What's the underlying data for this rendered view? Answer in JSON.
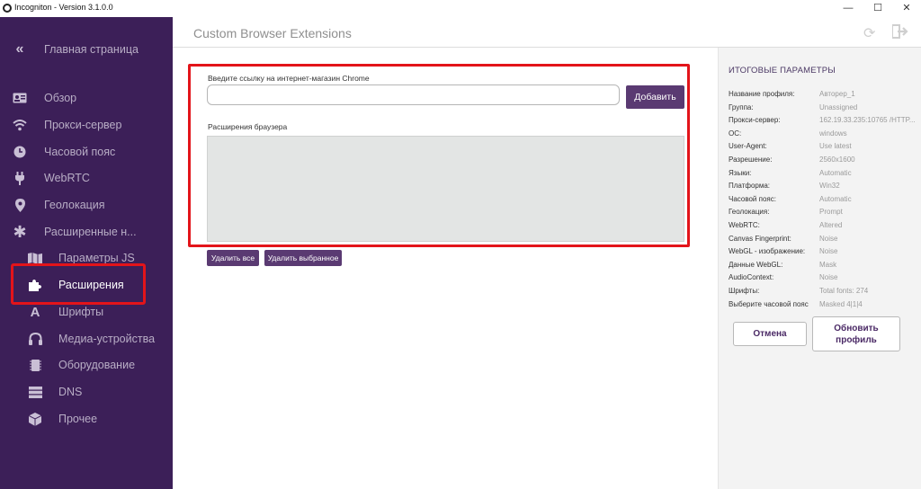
{
  "window": {
    "title": "Incogniton - Version 3.1.0.0",
    "controls": {
      "minimize": "—",
      "maximize": "☐",
      "close": "✕"
    }
  },
  "sidebar": {
    "collapse_icon": "«",
    "home_label": "Главная страница",
    "items": [
      {
        "label": "Обзор",
        "icon": "id-card-icon"
      },
      {
        "label": "Прокси-сервер",
        "icon": "wifi-icon"
      },
      {
        "label": "Часовой пояс",
        "icon": "clock-icon"
      },
      {
        "label": "WebRTC",
        "icon": "plug-icon"
      },
      {
        "label": "Геолокация",
        "icon": "map-pin-icon"
      },
      {
        "label": "Расширенные н...",
        "icon": "asterisk-icon"
      },
      {
        "label": "Параметры JS",
        "icon": "map-icon"
      },
      {
        "label": "Расширения",
        "icon": "puzzle-icon",
        "active": true
      },
      {
        "label": "Шрифты",
        "icon": "font-icon"
      },
      {
        "label": "Медиа-устройства",
        "icon": "headphones-icon"
      },
      {
        "label": "Оборудование",
        "icon": "chip-icon"
      },
      {
        "label": "DNS",
        "icon": "server-icon"
      },
      {
        "label": "Прочее",
        "icon": "cube-icon"
      }
    ]
  },
  "main": {
    "title": "Custom Browser Extensions",
    "store_link_label": "Введите ссылку на интернет-магазин Chrome",
    "store_link_value": "",
    "add_button": "Добавить",
    "extensions_label": "Расширения браузера",
    "delete_all_button": "Удалить все",
    "delete_selected_button": "Удалить выбранное"
  },
  "summary": {
    "title": "ИТОГОВЫЕ ПАРАМЕТРЫ",
    "rows": [
      {
        "key": "Название профиля:",
        "value": "Авторер_1"
      },
      {
        "key": "Группа:",
        "value": "Unassigned"
      },
      {
        "key": "Прокси-сервер:",
        "value": "162.19.33.235:10765 /HTTP..."
      },
      {
        "key": "ОС:",
        "value": "windows"
      },
      {
        "key": "User-Agent:",
        "value": "Use latest"
      },
      {
        "key": "Разрешение:",
        "value": "2560x1600"
      },
      {
        "key": "Языки:",
        "value": "Automatic"
      },
      {
        "key": "Платформа:",
        "value": "Win32"
      },
      {
        "key": "Часовой пояс:",
        "value": "Automatic"
      },
      {
        "key": "Геолокация:",
        "value": "Prompt"
      },
      {
        "key": "WebRTC:",
        "value": "Altered"
      },
      {
        "key": "Canvas Fingerprint:",
        "value": "Noise"
      },
      {
        "key": "WebGL - изображение:",
        "value": "Noise"
      },
      {
        "key": "Данные WebGL:",
        "value": "Mask"
      },
      {
        "key": "AudioContext:",
        "value": "Noise"
      },
      {
        "key": "Шрифты:",
        "value": "Total fonts: 274"
      },
      {
        "key": "Выберите часовой пояс",
        "value": "Masked 4|1|4"
      }
    ],
    "cancel_button": "Отмена",
    "update_button": "Обновить профиль"
  },
  "colors": {
    "sidebar_bg": "#3c1f58",
    "accent": "#5a3a72",
    "highlight": "#e3141a"
  }
}
